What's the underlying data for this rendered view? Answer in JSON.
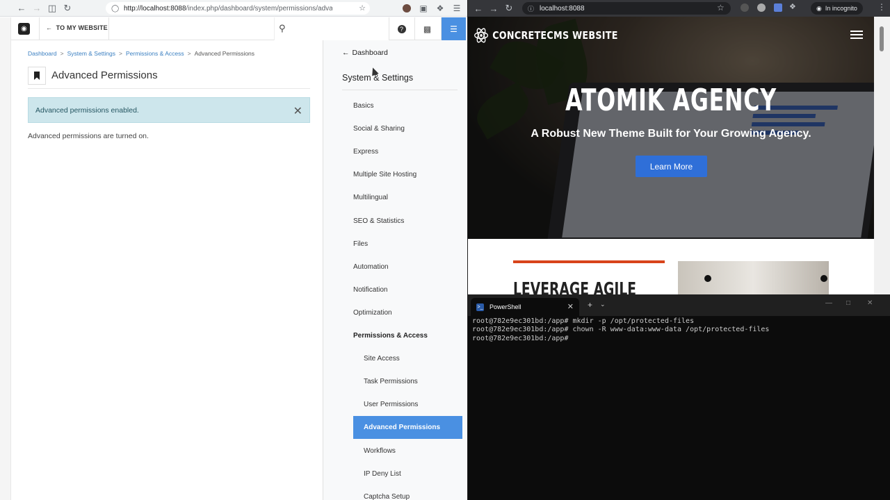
{
  "left_browser": {
    "url_host": "http://localhost:8088",
    "url_path": "/index.php/dashboard/system/permissions/advanced/permissio",
    "toolbar": {
      "to_my_website": "TO MY WEBSITE"
    },
    "breadcrumb": [
      "Dashboard",
      "System & Settings",
      "Permissions & Access",
      "Advanced Permissions"
    ],
    "page_title": "Advanced Permissions",
    "alert_text": "Advanced permissions enabled.",
    "body_text": "Advanced permissions are turned on.",
    "panel": {
      "back_label": "Dashboard",
      "section_title": "System & Settings",
      "items": [
        "Basics",
        "Social & Sharing",
        "Express",
        "Multiple Site Hosting",
        "Multilingual",
        "SEO & Statistics",
        "Files",
        "Automation",
        "Notification",
        "Optimization",
        "Permissions & Access"
      ],
      "sub_items": [
        "Site Access",
        "Task Permissions",
        "User Permissions",
        "Advanced Permissions",
        "Workflows",
        "IP Deny List",
        "Captcha Setup"
      ],
      "active_item": "Advanced Permissions"
    }
  },
  "right_browser": {
    "url": "localhost:8088",
    "incognito_label": "In incognito",
    "site_brand": "CONCRETECMS WEBSITE",
    "hero_title": "ATOMIK AGENCY",
    "hero_subtitle": "A Robust New Theme Built for Your Growing Agency.",
    "hero_button": "Learn More",
    "section_heading": "LEVERAGE AGILE",
    "accent_color": "#2f6fd8"
  },
  "terminal": {
    "tab_title": "PowerShell",
    "lines": [
      "root@782e9ec301bd:/app# mkdir -p /opt/protected-files",
      "root@782e9ec301bd:/app# chown -R www-data:www-data /opt/protected-files",
      "root@782e9ec301bd:/app# "
    ]
  }
}
